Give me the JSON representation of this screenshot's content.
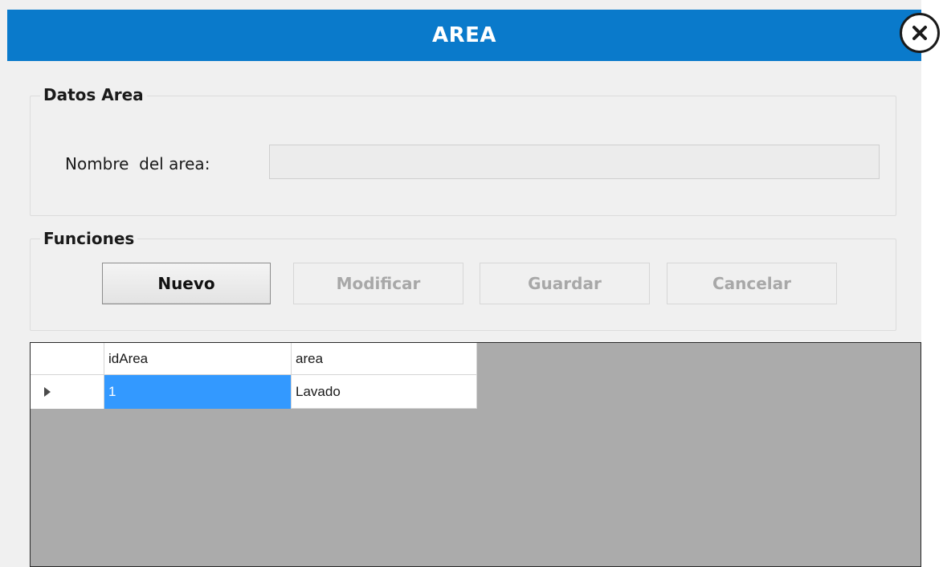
{
  "window": {
    "title": "AREA",
    "close_icon": "close-icon",
    "accent_color": "#0a7acb"
  },
  "datos_area": {
    "legend": "Datos Area",
    "nombre_label": "Nombre  del area:",
    "nombre_value": "",
    "nombre_placeholder": ""
  },
  "funciones": {
    "legend": "Funciones",
    "buttons": [
      {
        "label": "Nuevo",
        "enabled": true
      },
      {
        "label": "Modificar",
        "enabled": false
      },
      {
        "label": "Guardar",
        "enabled": false
      },
      {
        "label": "Cancelar",
        "enabled": false
      }
    ]
  },
  "grid": {
    "columns": [
      "idArea",
      "area"
    ],
    "rows": [
      {
        "idArea": "1",
        "area": "Lavado",
        "current": true
      }
    ],
    "row_indicator_icon": "arrow-right-icon",
    "selected_color": "#3399ff"
  }
}
